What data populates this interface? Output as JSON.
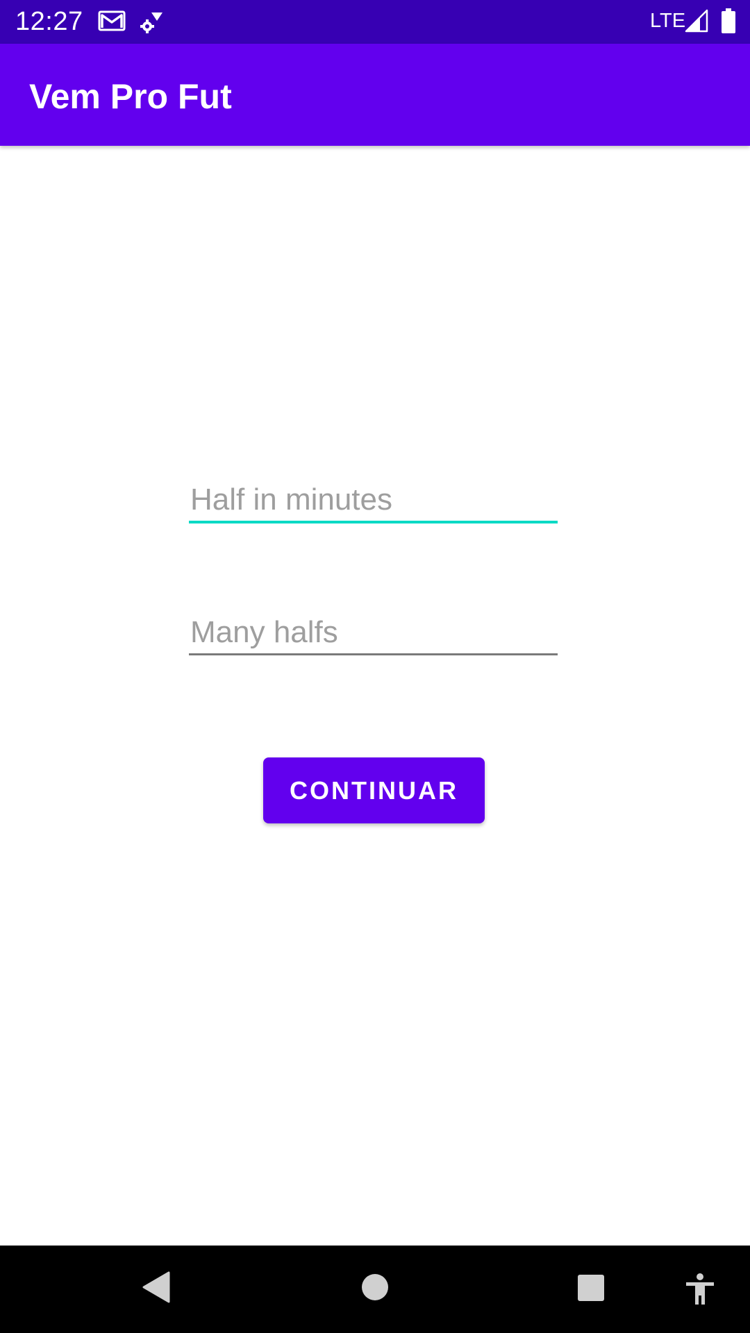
{
  "status_bar": {
    "time": "12:27",
    "network": "LTE",
    "icons": [
      "gmail-icon",
      "sync-icon",
      "signal-icon",
      "battery-icon"
    ],
    "background_color": "#3700B3"
  },
  "app_bar": {
    "title": "Vem Pro Fut",
    "background_color": "#6200EE"
  },
  "form": {
    "half_minutes": {
      "placeholder": "Half in minutes",
      "value": "",
      "focused": true,
      "accent_color": "#03DAC5"
    },
    "many_halfs": {
      "placeholder": "Many halfs",
      "value": "",
      "focused": false
    },
    "continue_label": "CONTINUAR"
  },
  "nav_bar": {
    "icons": [
      "back-icon",
      "home-icon",
      "recents-icon",
      "accessibility-icon"
    ]
  }
}
